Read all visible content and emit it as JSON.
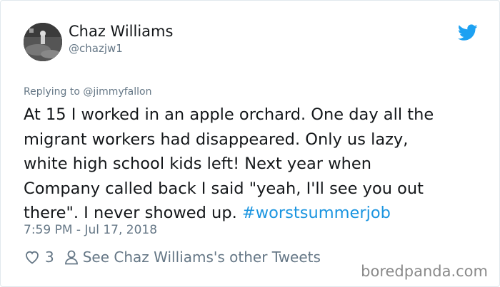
{
  "author": {
    "display_name": "Chaz Williams",
    "handle": "@chazjw1",
    "avatar_icon": "user-photo-avatar"
  },
  "reply": {
    "prefix": "Replying to ",
    "mention": "@jimmyfallon"
  },
  "tweet": {
    "body_line_1": "At 15 I worked in an apple orchard. One day all the",
    "body_line_2": "migrant workers had disappeared. Only us lazy,",
    "body_line_3": "white high school kids left!  Next year when",
    "body_line_4": "Company called back I said \"yeah, I'll see you out",
    "body_line_5": "there\". I never showed up. ",
    "hashtag": "#worstsummerjob",
    "timestamp": "7:59 PM - Jul 17, 2018"
  },
  "actions": {
    "like_icon": "heart-icon",
    "like_count": "3",
    "profile_icon": "person-icon",
    "other_tweets_label": "See Chaz Williams's other Tweets"
  },
  "branding": {
    "bird_icon": "twitter-bird-icon",
    "watermark": "boredpanda.com"
  },
  "colors": {
    "text": "#14171a",
    "muted": "#657786",
    "link": "#1b95e0",
    "twitter_blue": "#1da1f2",
    "border": "#e1e8ed"
  }
}
